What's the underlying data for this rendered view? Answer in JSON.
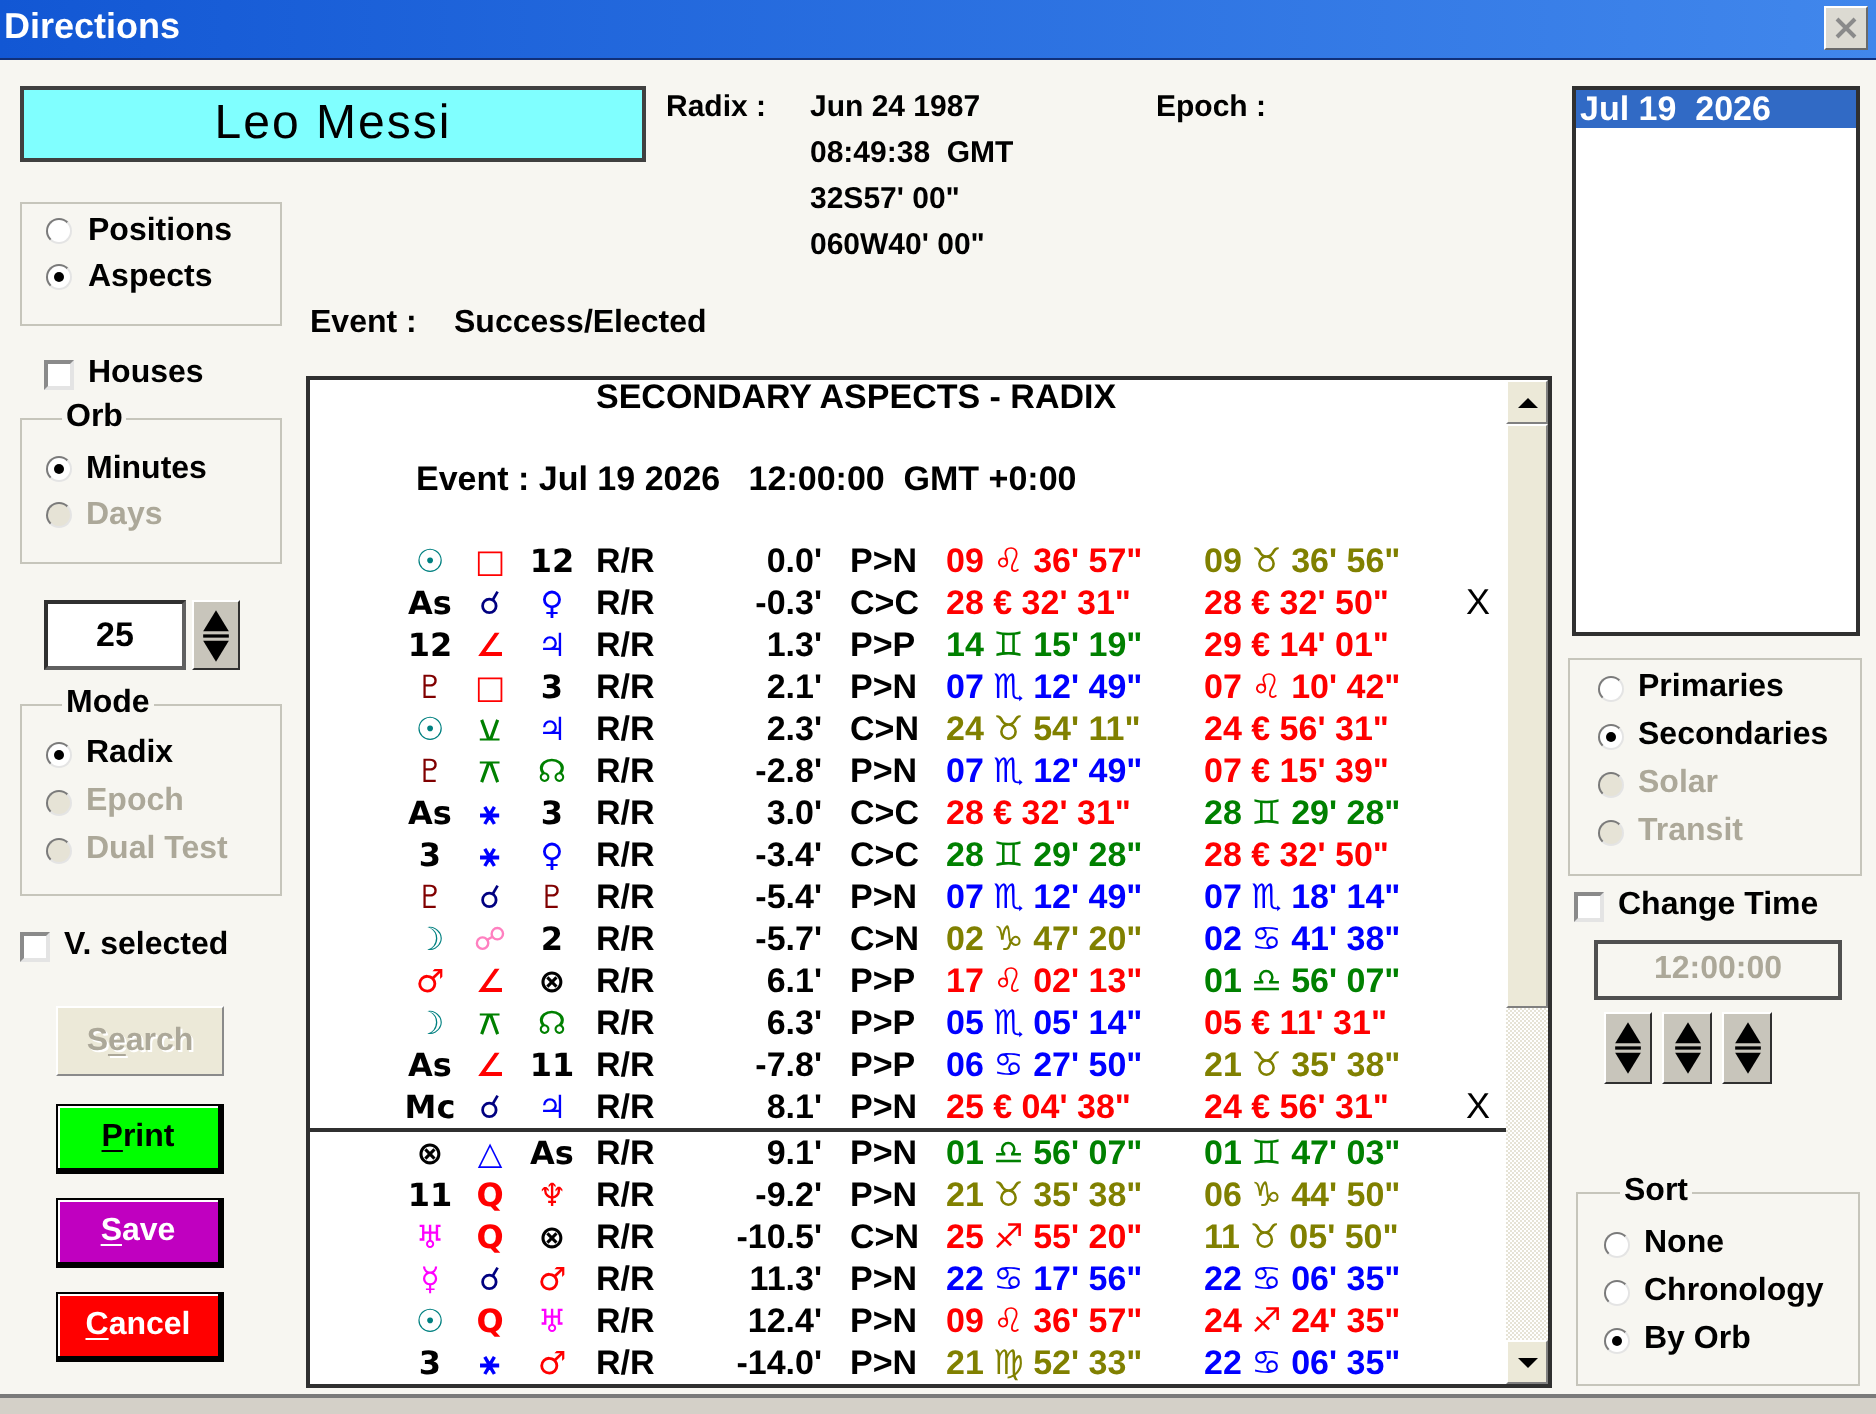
{
  "window": {
    "title": "Directions"
  },
  "person": {
    "name": "Leo Messi"
  },
  "radix": {
    "label": "Radix :",
    "lines": [
      "Jun 24 1987",
      "08:49:38  GMT",
      "32S57' 00\"",
      "060W40' 00\""
    ]
  },
  "epoch": {
    "label": "Epoch :"
  },
  "event": {
    "label": "Event :",
    "value": "Success/Elected"
  },
  "display_options": [
    {
      "label": "Positions",
      "selected": false,
      "disabled": false
    },
    {
      "label": "Aspects",
      "selected": true,
      "disabled": false
    }
  ],
  "houses": {
    "label": "Houses",
    "checked": false
  },
  "orb": {
    "title": "Orb",
    "options": [
      {
        "label": "Minutes",
        "selected": true,
        "disabled": false
      },
      {
        "label": "Days",
        "selected": false,
        "disabled": true
      }
    ],
    "value": "25"
  },
  "mode": {
    "title": "Mode",
    "options": [
      {
        "label": "Radix",
        "selected": true,
        "disabled": false
      },
      {
        "label": "Epoch",
        "selected": false,
        "disabled": true
      },
      {
        "label": "Dual Test",
        "selected": false,
        "disabled": true
      }
    ]
  },
  "v_selected": {
    "label": "V. selected",
    "checked": false
  },
  "buttons": [
    {
      "before": "S",
      "underlined": "e",
      "after": "arch",
      "color": "#ece9d8",
      "disabled": true
    },
    {
      "underlined": "P",
      "after": "rint",
      "color": "#00ff00",
      "disabled": false
    },
    {
      "underlined": "S",
      "after": "ave",
      "color": "#c000c0",
      "disabled": false
    },
    {
      "underlined": "C",
      "after": "ancel",
      "color": "#ff0000",
      "disabled": false
    }
  ],
  "report": {
    "title": "SECONDARY ASPECTS - RADIX",
    "event_line": "Event : Jul 19 2026   12:00:00  GMT +0:00",
    "groups": [
      {
        "rows": [
          {
            "column_1": {
              "text": "☉",
              "color": "#008080"
            },
            "column_2": {
              "text": "□",
              "color": "#ff0000"
            },
            "column_3": {
              "text": "12",
              "color": "#000000"
            },
            "column_4": "R/R",
            "column_5": "0.0'",
            "column_6": "P>N",
            "column_7": {
              "text": "09 ♌ 36' 57\"",
              "color": "#ff0000"
            },
            "column_8": {
              "text": "09 ♉ 36' 56\"",
              "color": "#808000"
            }
          },
          {
            "column_1": {
              "text": "As",
              "color": "#000000"
            },
            "column_2": {
              "text": "☌",
              "color": "#000080"
            },
            "column_3": {
              "text": "♀",
              "color": "#0000ff"
            },
            "column_4": "R/R",
            "column_5": "-0.3'",
            "column_6": "C>C",
            "column_7": {
              "text": "28 € 32' 31\"",
              "color": "#ff0000"
            },
            "column_8": {
              "text": "28 € 32' 50\"",
              "color": "#ff0000"
            },
            "column_9": "X"
          },
          {
            "column_1": {
              "text": "12",
              "color": "#000000"
            },
            "column_2": {
              "text": "∠",
              "color": "#ff0000"
            },
            "column_3": {
              "text": "♃",
              "color": "#0000ff"
            },
            "column_4": "R/R",
            "column_5": "1.3'",
            "column_6": "P>P",
            "column_7": {
              "text": "14 ♊ 15' 19\"",
              "color": "#008000"
            },
            "column_8": {
              "text": "29 € 14' 01\"",
              "color": "#ff0000"
            }
          },
          {
            "column_1": {
              "text": "♇",
              "color": "#800000"
            },
            "column_2": {
              "text": "□",
              "color": "#ff0000"
            },
            "column_3": {
              "text": "3",
              "color": "#000000"
            },
            "column_4": "R/R",
            "column_5": "2.1'",
            "column_6": "P>N",
            "column_7": {
              "text": "07 ♏ 12' 49\"",
              "color": "#0000ff"
            },
            "column_8": {
              "text": "07 ♌ 10' 42\"",
              "color": "#ff0000"
            }
          },
          {
            "column_1": {
              "text": "☉",
              "color": "#008080"
            },
            "column_2": {
              "text": "⚺",
              "color": "#008000"
            },
            "column_3": {
              "text": "♃",
              "color": "#0000ff"
            },
            "column_4": "R/R",
            "column_5": "2.3'",
            "column_6": "C>N",
            "column_7": {
              "text": "24 ♉ 54' 11\"",
              "color": "#808000"
            },
            "column_8": {
              "text": "24 € 56' 31\"",
              "color": "#ff0000"
            }
          },
          {
            "column_1": {
              "text": "♇",
              "color": "#800000"
            },
            "column_2": {
              "text": "⚻",
              "color": "#008000"
            },
            "column_3": {
              "text": "☊",
              "color": "#008000"
            },
            "column_4": "R/R",
            "column_5": "-2.8'",
            "column_6": "P>N",
            "column_7": {
              "text": "07 ♏ 12' 49\"",
              "color": "#0000ff"
            },
            "column_8": {
              "text": "07 € 15' 39\"",
              "color": "#ff0000"
            }
          },
          {
            "column_1": {
              "text": "As",
              "color": "#000000"
            },
            "column_2": {
              "text": "⚹",
              "color": "#0000ff"
            },
            "column_3": {
              "text": "3",
              "color": "#000000"
            },
            "column_4": "R/R",
            "column_5": "3.0'",
            "column_6": "C>C",
            "column_7": {
              "text": "28 € 32' 31\"",
              "color": "#ff0000"
            },
            "column_8": {
              "text": "28 ♊ 29' 28\"",
              "color": "#008000"
            }
          },
          {
            "column_1": {
              "text": "3",
              "color": "#000000"
            },
            "column_2": {
              "text": "⚹",
              "color": "#0000ff"
            },
            "column_3": {
              "text": "♀",
              "color": "#0000ff"
            },
            "column_4": "R/R",
            "column_5": "-3.4'",
            "column_6": "C>C",
            "column_7": {
              "text": "28 ♊ 29' 28\"",
              "color": "#008000"
            },
            "column_8": {
              "text": "28 € 32' 50\"",
              "color": "#ff0000"
            }
          },
          {
            "column_1": {
              "text": "♇",
              "color": "#800000"
            },
            "column_2": {
              "text": "☌",
              "color": "#000080"
            },
            "column_3": {
              "text": "♇",
              "color": "#800000"
            },
            "column_4": "R/R",
            "column_5": "-5.4'",
            "column_6": "P>N",
            "column_7": {
              "text": "07 ♏ 12' 49\"",
              "color": "#0000ff"
            },
            "column_8": {
              "text": "07 ♏ 18' 14\"",
              "color": "#0000ff"
            }
          },
          {
            "column_1": {
              "text": "☽",
              "color": "#008080"
            },
            "column_2": {
              "text": "☍",
              "color": "#ff80c0"
            },
            "column_3": {
              "text": "2",
              "color": "#000000"
            },
            "column_4": "R/R",
            "column_5": "-5.7'",
            "column_6": "C>N",
            "column_7": {
              "text": "02 ♑ 47' 20\"",
              "color": "#808000"
            },
            "column_8": {
              "text": "02 ♋ 41' 38\"",
              "color": "#0000ff"
            }
          },
          {
            "column_1": {
              "text": "♂",
              "color": "#ff0000"
            },
            "column_2": {
              "text": "∠",
              "color": "#ff0000"
            },
            "column_3": {
              "text": "⊗",
              "color": "#000000"
            },
            "column_4": "R/R",
            "column_5": "6.1'",
            "column_6": "P>P",
            "column_7": {
              "text": "17 ♌ 02' 13\"",
              "color": "#ff0000"
            },
            "column_8": {
              "text": "01 ♎ 56' 07\"",
              "color": "#008000"
            }
          },
          {
            "column_1": {
              "text": "☽",
              "color": "#008080"
            },
            "column_2": {
              "text": "⚻",
              "color": "#008000"
            },
            "column_3": {
              "text": "☊",
              "color": "#008000"
            },
            "column_4": "R/R",
            "column_5": "6.3'",
            "column_6": "P>P",
            "column_7": {
              "text": "05 ♏ 05' 14\"",
              "color": "#0000ff"
            },
            "column_8": {
              "text": "05 € 11' 31\"",
              "color": "#ff0000"
            }
          },
          {
            "column_1": {
              "text": "As",
              "color": "#000000"
            },
            "column_2": {
              "text": "∠",
              "color": "#ff0000"
            },
            "column_3": {
              "text": "11",
              "color": "#000000"
            },
            "column_4": "R/R",
            "column_5": "-7.8'",
            "column_6": "P>P",
            "column_7": {
              "text": "06 ♋ 27' 50\"",
              "color": "#0000ff"
            },
            "column_8": {
              "text": "21 ♉ 35' 38\"",
              "color": "#808000"
            }
          },
          {
            "column_1": {
              "text": "Mc",
              "color": "#000000"
            },
            "column_2": {
              "text": "☌",
              "color": "#000080"
            },
            "column_3": {
              "text": "♃",
              "color": "#0000ff"
            },
            "column_4": "R/R",
            "column_5": "8.1'",
            "column_6": "P>N",
            "column_7": {
              "text": "25 € 04' 38\"",
              "color": "#ff0000"
            },
            "column_8": {
              "text": "24 € 56' 31\"",
              "color": "#ff0000"
            },
            "column_9": "X"
          }
        ]
      },
      {
        "rows": [
          {
            "column_1": {
              "text": "⊗",
              "color": "#000000"
            },
            "column_2": {
              "text": "△",
              "color": "#0000ff"
            },
            "column_3": {
              "text": "As",
              "color": "#000000"
            },
            "column_4": "R/R",
            "column_5": "9.1'",
            "column_6": "P>N",
            "column_7": {
              "text": "01 ♎ 56' 07\"",
              "color": "#008000"
            },
            "column_8": {
              "text": "01 ♊ 47' 03\"",
              "color": "#008000"
            }
          },
          {
            "column_1": {
              "text": "11",
              "color": "#000000"
            },
            "column_2": {
              "text": "Q",
              "color": "#ff0000"
            },
            "column_3": {
              "text": "♆",
              "color": "#ff0000"
            },
            "column_4": "R/R",
            "column_5": "-9.2'",
            "column_6": "P>N",
            "column_7": {
              "text": "21 ♉ 35' 38\"",
              "color": "#808000"
            },
            "column_8": {
              "text": "06 ♑ 44' 50\"",
              "color": "#808000"
            }
          },
          {
            "column_1": {
              "text": "♅",
              "color": "#ff00ff"
            },
            "column_2": {
              "text": "Q",
              "color": "#ff0000"
            },
            "column_3": {
              "text": "⊗",
              "color": "#000000"
            },
            "column_4": "R/R",
            "column_5": "-10.5'",
            "column_6": "C>N",
            "column_7": {
              "text": "25 ♐ 55' 20\"",
              "color": "#ff0000"
            },
            "column_8": {
              "text": "11 ♉ 05' 50\"",
              "color": "#808000"
            }
          },
          {
            "column_1": {
              "text": "☿",
              "color": "#ff00ff"
            },
            "column_2": {
              "text": "☌",
              "color": "#000080"
            },
            "column_3": {
              "text": "♂",
              "color": "#ff0000"
            },
            "column_4": "R/R",
            "column_5": "11.3'",
            "column_6": "P>N",
            "column_7": {
              "text": "22 ♋ 17' 56\"",
              "color": "#0000ff"
            },
            "column_8": {
              "text": "22 ♋ 06' 35\"",
              "color": "#0000ff"
            }
          },
          {
            "column_1": {
              "text": "☉",
              "color": "#008080"
            },
            "column_2": {
              "text": "Q",
              "color": "#ff0000"
            },
            "column_3": {
              "text": "♅",
              "color": "#ff00ff"
            },
            "column_4": "R/R",
            "column_5": "12.4'",
            "column_6": "P>N",
            "column_7": {
              "text": "09 ♌ 36' 57\"",
              "color": "#ff0000"
            },
            "column_8": {
              "text": "24 ♐ 24' 35\"",
              "color": "#ff0000"
            }
          },
          {
            "column_1": {
              "text": "3",
              "color": "#000000"
            },
            "column_2": {
              "text": "⚹",
              "color": "#0000ff"
            },
            "column_3": {
              "text": "♂",
              "color": "#ff0000"
            },
            "column_4": "R/R",
            "column_5": "-14.0'",
            "column_6": "P>N",
            "column_7": {
              "text": "21 ♍ 52' 33\"",
              "color": "#808000"
            },
            "column_8": {
              "text": "22 ♋ 06' 35\"",
              "color": "#0000ff"
            }
          }
        ]
      }
    ]
  },
  "dates": [
    {
      "label": "Jul 19  2026",
      "selected": true
    }
  ],
  "direction_types": [
    {
      "label": "Primaries",
      "selected": false,
      "disabled": false
    },
    {
      "label": "Secondaries",
      "selected": true,
      "disabled": false
    },
    {
      "label": "Solar",
      "selected": false,
      "disabled": true
    },
    {
      "label": "Transit",
      "selected": false,
      "disabled": true
    }
  ],
  "change_time": {
    "label": "Change Time",
    "checked": false,
    "time": "12:00:00"
  },
  "sort": {
    "title": "Sort",
    "options": [
      {
        "label": "None",
        "selected": false,
        "disabled": false
      },
      {
        "label": "Chronology",
        "selected": false,
        "disabled": false
      },
      {
        "label": "By Orb",
        "selected": true,
        "disabled": false
      }
    ]
  }
}
